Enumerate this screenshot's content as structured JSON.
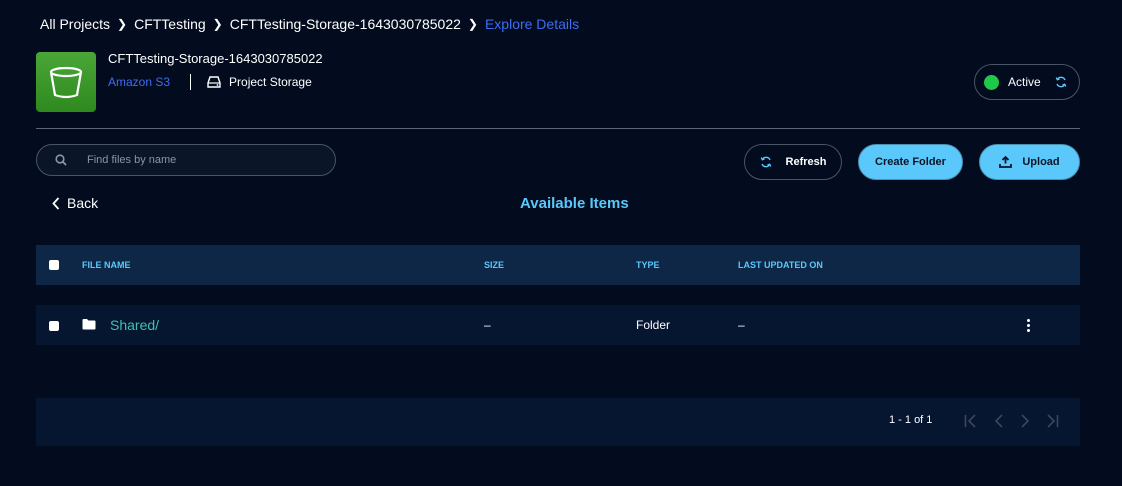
{
  "breadcrumb": {
    "items": [
      "All Projects",
      "CFTTesting",
      "CFTTesting-Storage-1643030785022"
    ],
    "current": "Explore Details"
  },
  "storage": {
    "name": "CFTTesting-Storage-1643030785022",
    "provider": "Amazon S3",
    "type_label": "Project Storage",
    "status": "Active",
    "status_color": "#1ec84a"
  },
  "search": {
    "placeholder": "Find files by name"
  },
  "actions": {
    "refresh": "Refresh",
    "create_folder": "Create Folder",
    "upload": "Upload"
  },
  "nav": {
    "back": "Back"
  },
  "section_title": "Available Items",
  "table": {
    "columns": [
      "FILE NAME",
      "SIZE",
      "TYPE",
      "LAST UPDATED ON"
    ],
    "rows": [
      {
        "name": "Shared/",
        "size": "–",
        "type": "Folder",
        "updated": "–"
      }
    ]
  },
  "pagination": {
    "label": "1 - 1 of 1"
  },
  "colors": {
    "background": "#020c1e",
    "accent": "#5ac8fa",
    "link": "#3f6cf2",
    "folder_link": "#3ec3b0"
  }
}
